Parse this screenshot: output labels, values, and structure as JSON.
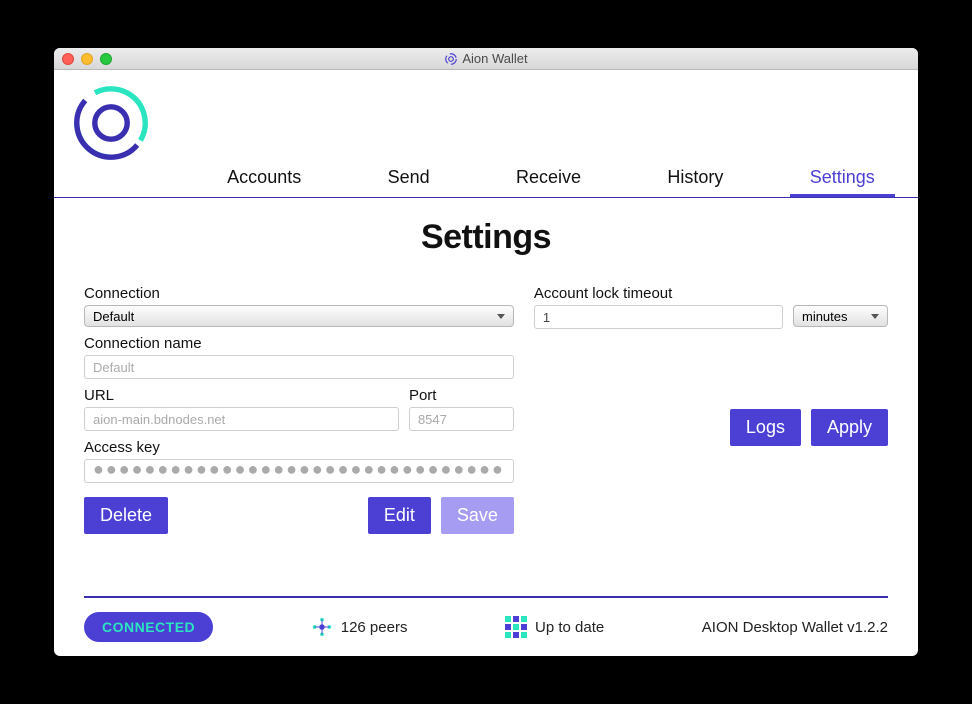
{
  "window": {
    "title": "Aion Wallet"
  },
  "nav": {
    "tabs": [
      "Accounts",
      "Send",
      "Receive",
      "History",
      "Settings"
    ],
    "active_index": 4
  },
  "page": {
    "title": "Settings"
  },
  "connection": {
    "section_label": "Connection",
    "selected": "Default",
    "name_label": "Connection name",
    "name_value": "Default",
    "url_label": "URL",
    "url_value": "aion-main.bdnodes.net",
    "port_label": "Port",
    "port_value": "8547",
    "access_key_label": "Access key",
    "access_key_masked": "●●●●●●●●●●●●●●●●●●●●●●●●●●●●●●●●",
    "delete_btn": "Delete",
    "edit_btn": "Edit",
    "save_btn": "Save"
  },
  "timeout": {
    "section_label": "Account lock timeout",
    "value": "1",
    "unit": "minutes",
    "logs_btn": "Logs",
    "apply_btn": "Apply"
  },
  "footer": {
    "status": "CONNECTED",
    "peers": "126 peers",
    "sync": "Up to date",
    "version": "AION Desktop Wallet v1.2.2"
  }
}
